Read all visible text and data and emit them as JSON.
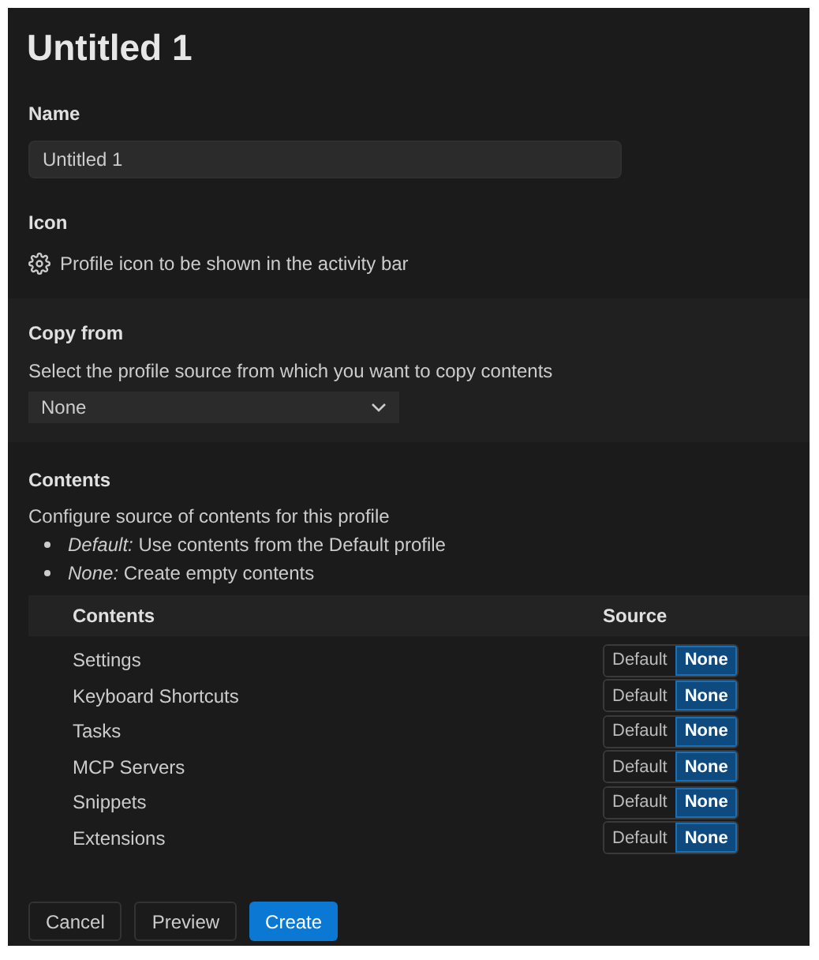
{
  "title": "Untitled 1",
  "name": {
    "label": "Name",
    "value": "Untitled 1"
  },
  "icon": {
    "label": "Icon",
    "description": "Profile icon to be shown in the activity bar"
  },
  "copy_from": {
    "label": "Copy from",
    "description": "Select the profile source from which you want to copy contents",
    "value": "None"
  },
  "contents": {
    "label": "Contents",
    "description": "Configure source of contents for this profile",
    "bullets": [
      "*Default:* Use contents from the Default profile",
      "*None:* Create empty contents"
    ],
    "columns": [
      "Contents",
      "Source"
    ],
    "rows": [
      {
        "name": "Settings",
        "options": [
          {
            "label": "Default",
            "selected": false
          },
          {
            "label": "None",
            "selected": true
          }
        ]
      },
      {
        "name": "Keyboard Shortcuts",
        "options": [
          {
            "label": "Default",
            "selected": false
          },
          {
            "label": "None",
            "selected": true
          }
        ]
      },
      {
        "name": "Tasks",
        "options": [
          {
            "label": "Default",
            "selected": false
          },
          {
            "label": "None",
            "selected": true
          }
        ]
      },
      {
        "name": "MCP Servers",
        "options": [
          {
            "label": "Default",
            "selected": false
          },
          {
            "label": "None",
            "selected": true
          }
        ]
      },
      {
        "name": "Snippets",
        "options": [
          {
            "label": "Default",
            "selected": false
          },
          {
            "label": "None",
            "selected": true
          }
        ]
      },
      {
        "name": "Extensions",
        "options": [
          {
            "label": "Default",
            "selected": false
          },
          {
            "label": "None",
            "selected": true
          }
        ]
      }
    ]
  },
  "buttons": [
    {
      "label": "Cancel",
      "kind": "secondary"
    },
    {
      "label": "Preview",
      "kind": "secondary"
    },
    {
      "label": "Create",
      "kind": "primary"
    }
  ]
}
